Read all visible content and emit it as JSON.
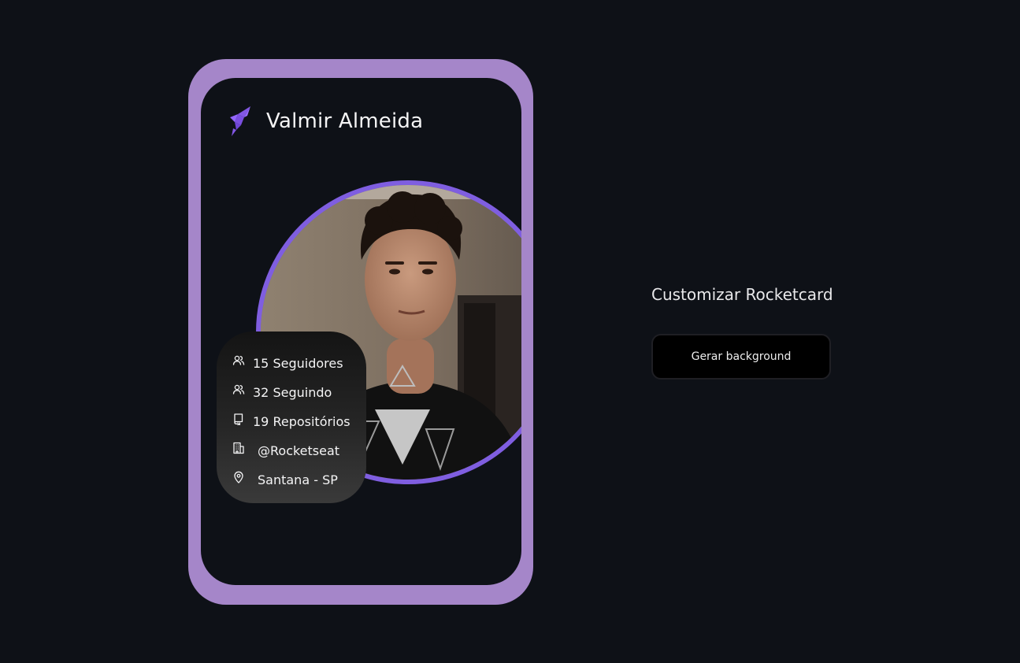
{
  "card": {
    "name": "Valmir Almeida",
    "logo_icon": "rocket-icon",
    "accent_color": "#7f5ee0",
    "frame_color": "#a586c9",
    "stats": {
      "followers": "15 Seguidores",
      "following": "32 Seguindo",
      "repos": "19 Repositórios",
      "company": "@Rocketseat",
      "location": "Santana - SP"
    },
    "stat_icons": [
      "users-icon",
      "users-icon",
      "book-icon",
      "building-icon",
      "map-pin-icon"
    ]
  },
  "customize": {
    "title": "Customizar Rocketcard",
    "button_label": "Gerar background"
  }
}
